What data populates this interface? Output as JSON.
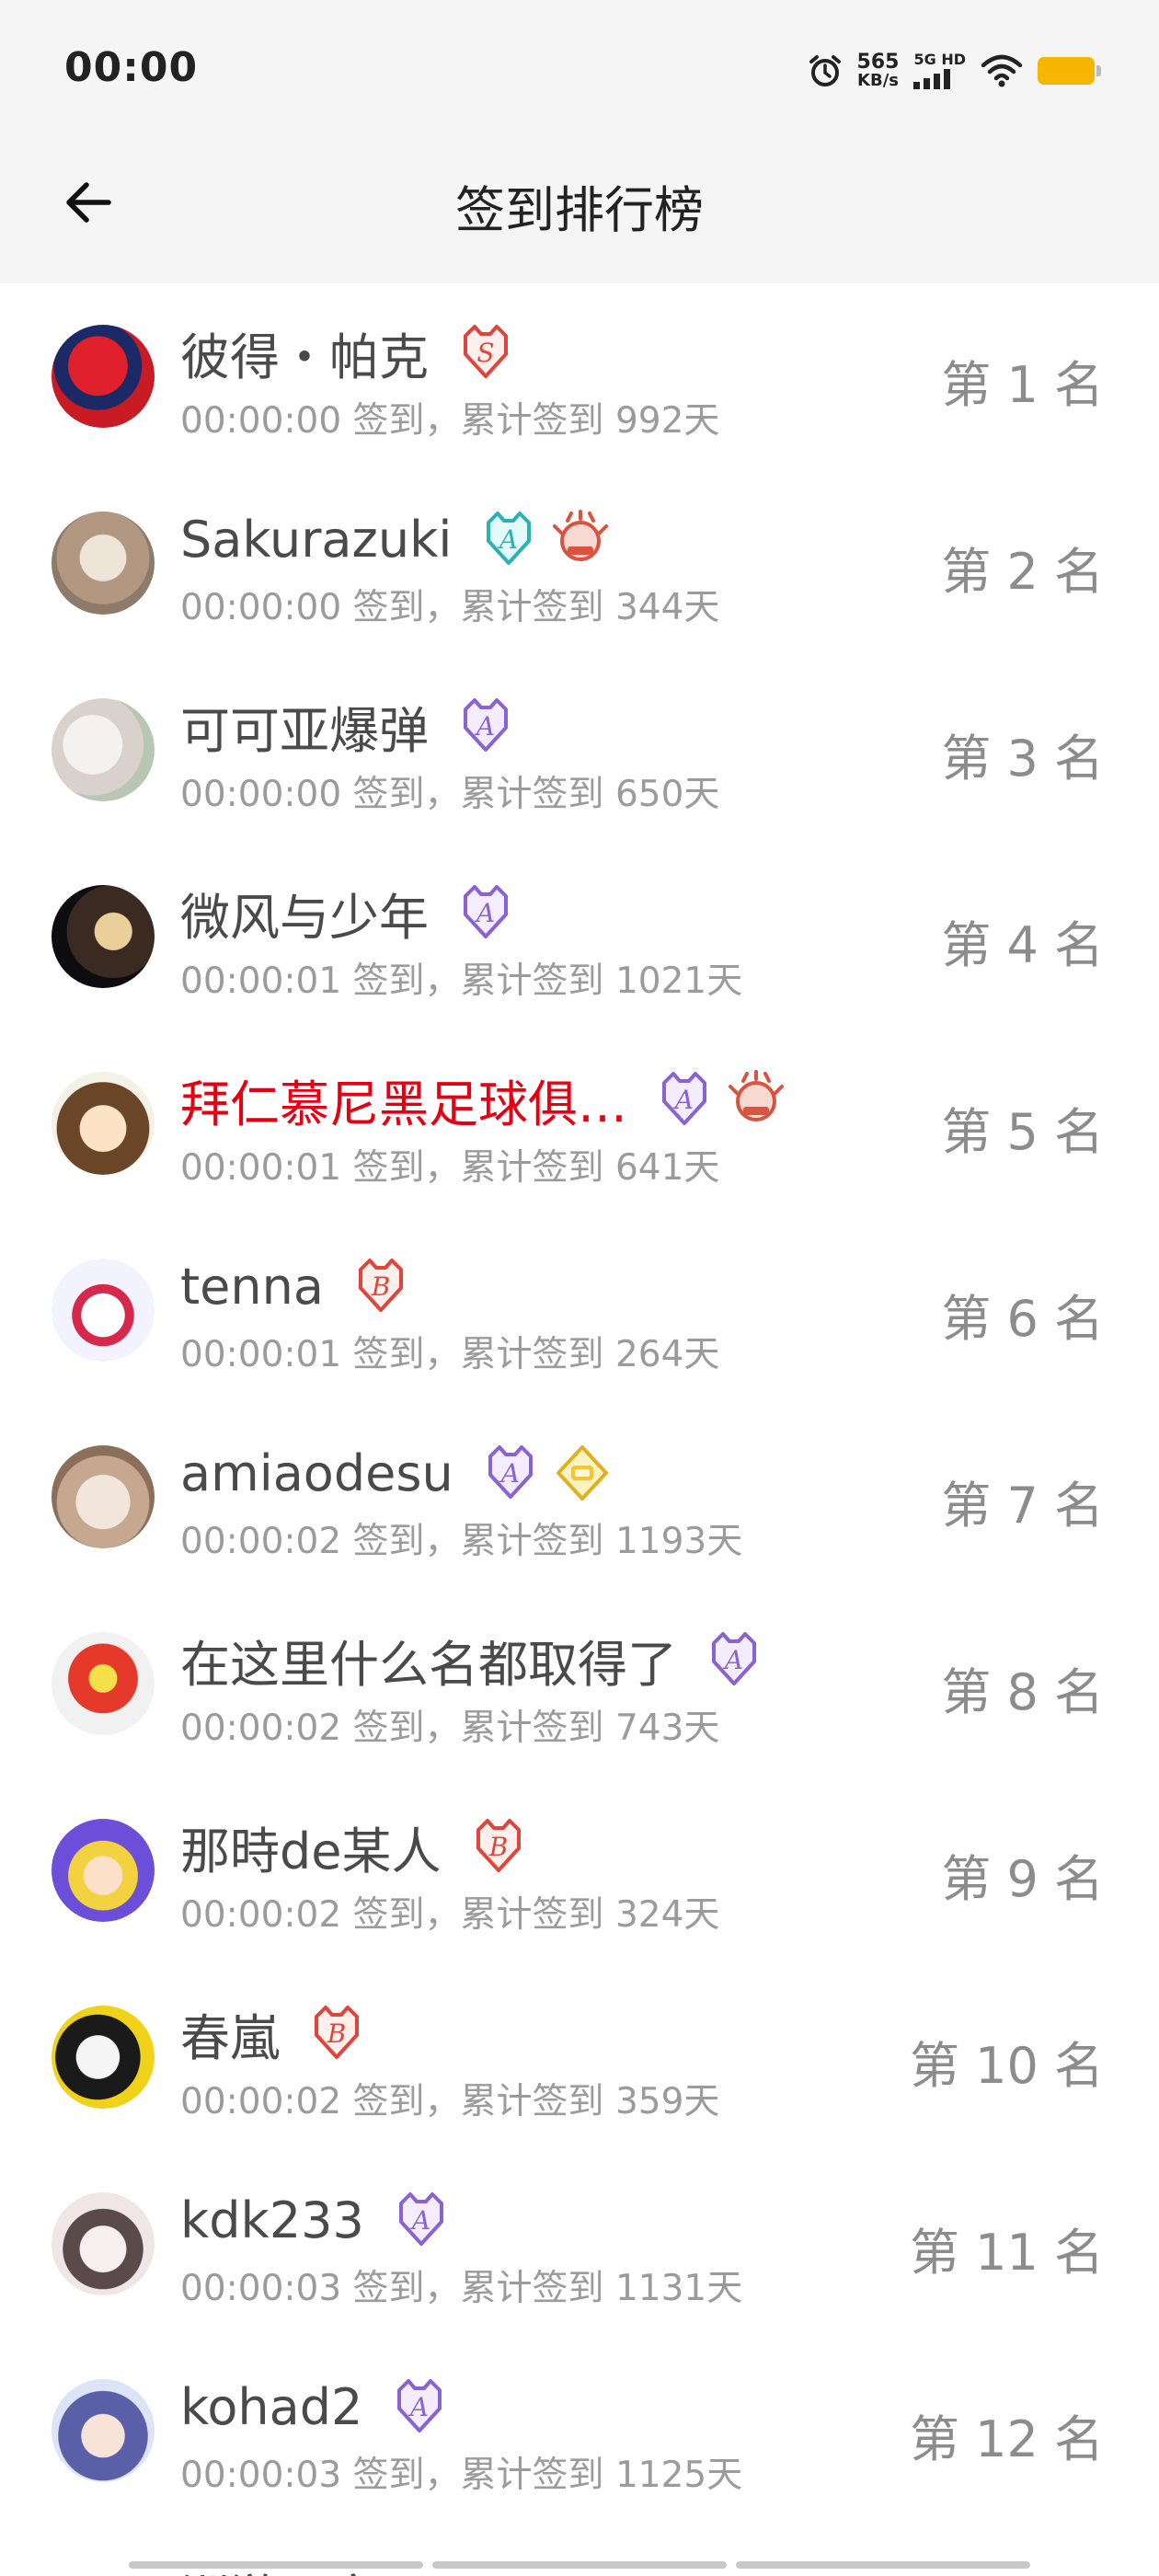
{
  "status": {
    "time": "00:00",
    "speed_value": "565",
    "speed_unit": "KB/s",
    "signal_label": "5G HD"
  },
  "header": {
    "title": "签到排行榜"
  },
  "rows": [
    {
      "name": "彼得・帕克",
      "sub": "00:00:00 签到，累计签到 992天",
      "rank": "第 1 名",
      "badges": [
        "S"
      ],
      "avatar": "spider"
    },
    {
      "name": "Sakurazuki",
      "sub": "00:00:00 签到，累计签到 344天",
      "rank": "第 2 名",
      "badges": [
        "A-teal",
        "crest"
      ],
      "avatar": "girl-brown"
    },
    {
      "name": "可可亚爆弹",
      "sub": "00:00:00 签到，累计签到 650天",
      "rank": "第 3 名",
      "badges": [
        "A"
      ],
      "avatar": "girl-white"
    },
    {
      "name": "微风与少年",
      "sub": "00:00:01 签到，累计签到 1021天",
      "rank": "第 4 名",
      "badges": [
        "A"
      ],
      "avatar": "dark"
    },
    {
      "name": "拜仁慕尼黑足球俱…",
      "sub": "00:00:01 签到，累计签到 641天",
      "rank": "第 5 名",
      "badges": [
        "A",
        "crest"
      ],
      "avatar": "yui",
      "red": true
    },
    {
      "name": "tenna",
      "sub": "00:00:01 签到，累计签到 264天",
      "rank": "第 6 名",
      "badges": [
        "B"
      ],
      "avatar": "robot"
    },
    {
      "name": "amiaodesu",
      "sub": "00:00:02 签到，累计签到 1193天",
      "rank": "第 7 名",
      "badges": [
        "A",
        "gold"
      ],
      "avatar": "cat"
    },
    {
      "name": "在这里什么名都取得了",
      "sub": "00:00:02 签到，累计签到 743天",
      "rank": "第 8 名",
      "badges": [
        "A"
      ],
      "avatar": "clown"
    },
    {
      "name": "那時de某人",
      "sub": "00:00:02 签到，累计签到 324天",
      "rank": "第 9 名",
      "badges": [
        "B"
      ],
      "avatar": "colorful"
    },
    {
      "name": "春嵐",
      "sub": "00:00:02 签到，累计签到 359天",
      "rank": "第 10 名",
      "badges": [
        "B"
      ],
      "avatar": "mask"
    },
    {
      "name": "kdk233",
      "sub": "00:00:03 签到，累计签到 1131天",
      "rank": "第 11 名",
      "badges": [
        "A"
      ],
      "avatar": "girl-red"
    },
    {
      "name": "kohad2",
      "sub": "00:00:03 签到，累计签到 1125天",
      "rank": "第 12 名",
      "badges": [
        "A"
      ],
      "avatar": "girl-blue"
    }
  ],
  "peek_text": "洲游现实",
  "colors": {
    "accent_red": "#e60012",
    "badge_purple": "#8a63d2",
    "badge_teal": "#2bb3b1",
    "badge_red": "#e0443a",
    "badge_gold": "#e0b020",
    "battery": "#f7b500"
  }
}
